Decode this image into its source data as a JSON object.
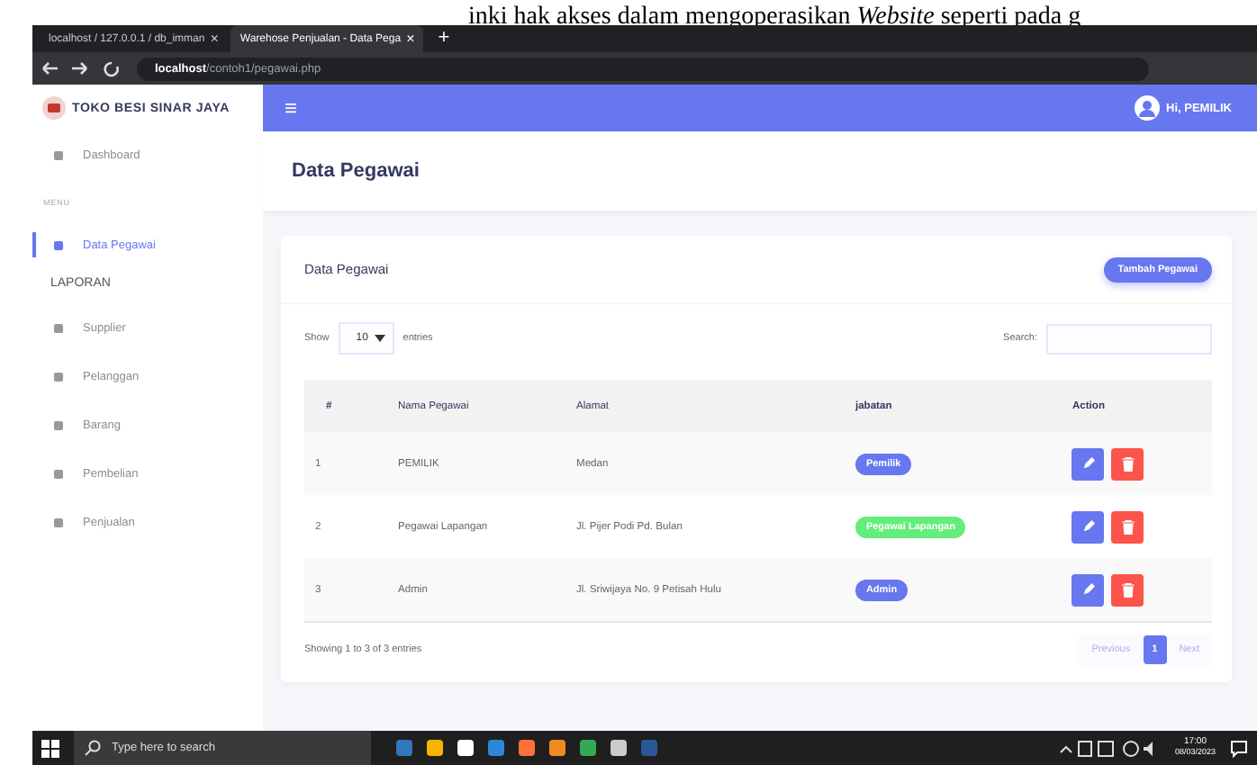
{
  "document_text": "inki hak akses dalam mengoperasikan *Website* seperti pada g",
  "browser": {
    "tabs": [
      {
        "label": "localhost / 127.0.0.1 / db_imman",
        "selected": false
      },
      {
        "label": "Warehose Penjualan - Data Pega",
        "selected": true
      }
    ],
    "close_glyph": "×",
    "new_tab_glyph": "+",
    "url_host": "localhost",
    "url_path": "/contoh1/pegawai.php"
  },
  "sidebar": {
    "brand": "TOKO BESI SINAR JAYA",
    "items": [
      {
        "kind": "link",
        "label": "Dashboard",
        "selected": false
      },
      {
        "kind": "heading",
        "label": "MENU"
      },
      {
        "kind": "link",
        "label": "Data Pegawai",
        "selected": true
      },
      {
        "kind": "section",
        "label": "LAPORAN"
      },
      {
        "kind": "link",
        "label": "Supplier",
        "selected": false
      },
      {
        "kind": "link",
        "label": "Pelanggan",
        "selected": false
      },
      {
        "kind": "link",
        "label": "Barang",
        "selected": false
      },
      {
        "kind": "link",
        "label": "Pembelian",
        "selected": false
      },
      {
        "kind": "link",
        "label": "Penjualan",
        "selected": false
      }
    ]
  },
  "topbar": {
    "menu_glyph": "≡",
    "user": "Hi, PEMILIK"
  },
  "page_title": "Data Pegawai",
  "card": {
    "title": "Data Pegawai",
    "add_button": "Tambah Pegawai",
    "show_label": "Show",
    "page_size": "10",
    "entries_label": "entries",
    "search_label": "Search:",
    "columns": [
      "#",
      "Nama Pegawai",
      "Alamat",
      "jabatan",
      "Action"
    ],
    "rows": [
      {
        "no": "1",
        "name": "PEMILIK",
        "address": "Medan",
        "role": "Pemilik",
        "color": "#6777ef"
      },
      {
        "no": "2",
        "name": "Pegawai Lapangan",
        "address": "Jl. Pijer Podi Pd. Bulan",
        "role": "Pegawai Lapangan",
        "color": "#63ed7a"
      },
      {
        "no": "3",
        "name": "Admin",
        "address": "Jl. Sriwijaya No. 9 Petisah Hulu",
        "role": "Admin",
        "color": "#6777ef"
      }
    ],
    "info": "Showing 1 to 3 of 3 entries",
    "pages": [
      {
        "label": "Previous",
        "kind": "nav",
        "selected": false
      },
      {
        "label": "1",
        "kind": "page",
        "selected": true
      },
      {
        "label": "Next",
        "kind": "nav",
        "selected": false
      }
    ]
  },
  "taskbar": {
    "search_placeholder": "Type here to search",
    "time": "17:00",
    "date": "08/03/2023"
  }
}
